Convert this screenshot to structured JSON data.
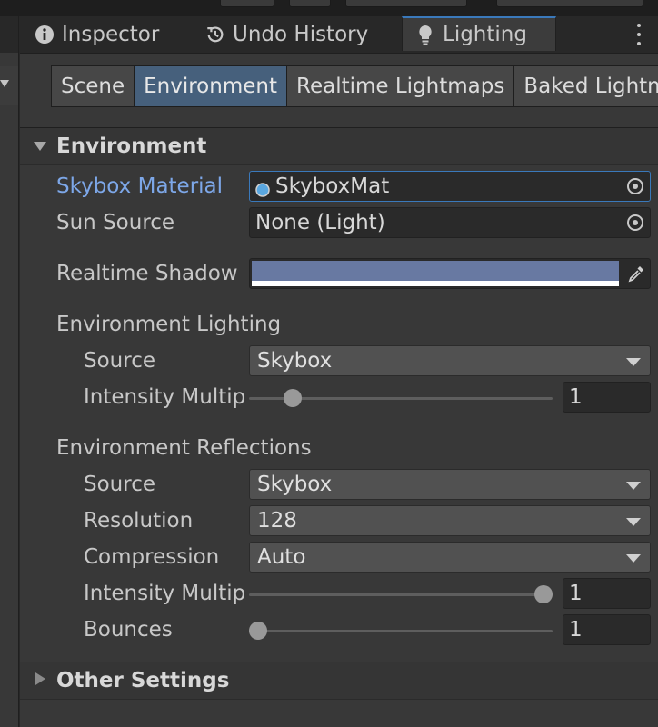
{
  "window": {
    "tabs": [
      {
        "label": "Inspector",
        "icon": "info-icon",
        "active": false
      },
      {
        "label": "Undo History",
        "icon": "history-icon",
        "active": false
      },
      {
        "label": "Lighting",
        "icon": "lightbulb-icon",
        "active": true
      }
    ],
    "menu_icon": "kebab-menu-icon"
  },
  "subtabs": [
    {
      "label": "Scene",
      "active": false
    },
    {
      "label": "Environment",
      "active": true
    },
    {
      "label": "Realtime Lightmaps",
      "active": false
    },
    {
      "label": "Baked Lightm",
      "active": false
    }
  ],
  "environment": {
    "title": "Environment",
    "skybox_material": {
      "label": "Skybox Material",
      "value": "SkyboxMat"
    },
    "sun_source": {
      "label": "Sun Source",
      "value": "None (Light)"
    },
    "realtime_shadow_color": {
      "label": "Realtime Shadow C",
      "color": "#6879a2"
    },
    "lighting": {
      "header": "Environment Lighting",
      "source": {
        "label": "Source",
        "value": "Skybox"
      },
      "intensity": {
        "label": "Intensity Multipl",
        "value": "1",
        "slider_fraction": 0.125
      }
    },
    "reflections": {
      "header": "Environment Reflections",
      "source": {
        "label": "Source",
        "value": "Skybox"
      },
      "resolution": {
        "label": "Resolution",
        "value": "128"
      },
      "compression": {
        "label": "Compression",
        "value": "Auto"
      },
      "intensity": {
        "label": "Intensity Multipl",
        "value": "1",
        "slider_fraction": 1.0
      },
      "bounces": {
        "label": "Bounces",
        "value": "1",
        "slider_fraction": 0.0
      }
    }
  },
  "other_settings": {
    "title": "Other Settings"
  },
  "colors": {
    "accent": "#3a79bb",
    "highlight_label": "#7da7e8",
    "active_subtab": "#46607c"
  }
}
